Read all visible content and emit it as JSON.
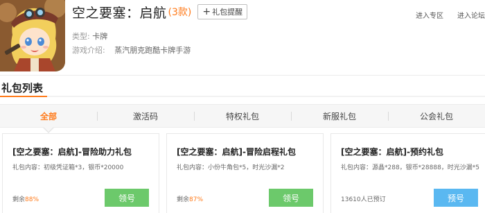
{
  "game": {
    "title": "空之要塞：启航",
    "count": "(3款)",
    "remind_label": "礼包提醒",
    "type_label": "类型:",
    "type_value": "卡牌",
    "intro_label": "游戏介绍:",
    "intro_value": "蒸汽朋克跑酷卡牌手游",
    "links": [
      "进入专区",
      "进入论坛"
    ]
  },
  "section": {
    "title": "礼包列表"
  },
  "tabs": [
    "全部",
    "激活码",
    "特权礼包",
    "新服礼包",
    "公会礼包"
  ],
  "active_tab": "全部",
  "cards": [
    {
      "title": "[空之要塞：启航]-冒险助力礼包",
      "content": "礼包内容：初级凭证箱*3，银币*20000",
      "foot_prefix": "剩余",
      "foot_value": "88%",
      "button": "领号"
    },
    {
      "title": "[空之要塞：启航]-冒险启程礼包",
      "content": "礼包内容：小份牛角包*5，时光沙漏*2",
      "foot_prefix": "剩余",
      "foot_value": "87%",
      "button": "领号"
    },
    {
      "title": "[空之要塞：启航]-预约礼包",
      "content": "礼包内容：源晶*288，银币*28888，时光沙漏*5",
      "foot_text": "13610人已预订",
      "button": "预号"
    }
  ],
  "colors": {
    "accent": "#ff7a1a",
    "green_button": "#6cc96b",
    "blue_button": "#5ab8f1"
  }
}
